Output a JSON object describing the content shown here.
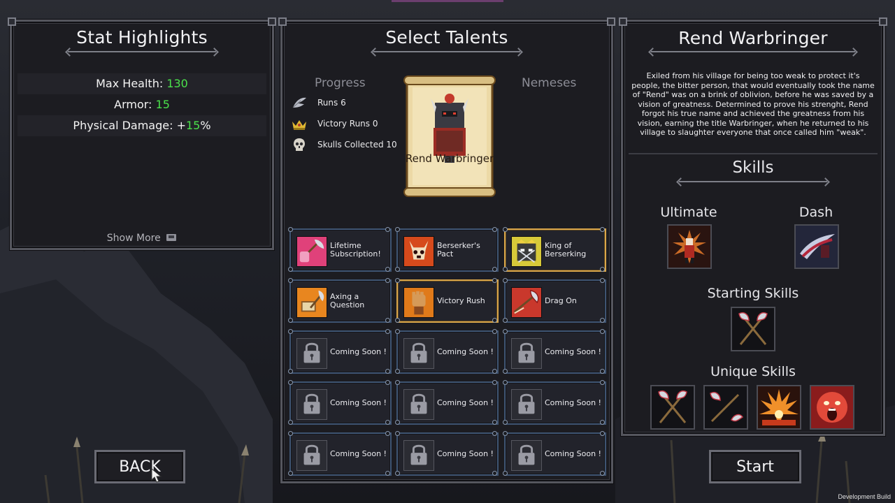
{
  "stat_highlights": {
    "title": "Stat Highlights",
    "stats": [
      {
        "label": "Max Health: ",
        "value": "130",
        "suffix": ""
      },
      {
        "label": "Armor: ",
        "value": "15",
        "suffix": ""
      },
      {
        "label": "Physical Damage: +",
        "value": "15",
        "suffix": "%"
      }
    ],
    "show_more": "Show More"
  },
  "select_talents": {
    "title": "Select Talents",
    "progress_header": "Progress",
    "nemeses_header": "Nemeses",
    "progress": [
      {
        "icon": "feather-wing-icon",
        "text": "Runs 6"
      },
      {
        "icon": "crown-icon",
        "text": "Victory Runs 0"
      },
      {
        "icon": "skull-icon",
        "text": "Skulls Collected 10"
      }
    ],
    "character_name": "Rend Warbringer",
    "talents": [
      {
        "name": "Lifetime Subscription!",
        "icon": "axe-shield-icon",
        "color": "#e0417a",
        "highlight": false
      },
      {
        "name": "Berserker's Pact",
        "icon": "demon-skull-icon",
        "color": "#d64a1c",
        "highlight": false
      },
      {
        "name": "King of Berserking",
        "icon": "crowned-face-icon",
        "color": "#d7c939",
        "highlight": true
      },
      {
        "name": "Axing a Question",
        "icon": "axe-book-icon",
        "color": "#e8861f",
        "highlight": false
      },
      {
        "name": "Victory Rush",
        "icon": "raised-fist-icon",
        "color": "#e07a1a",
        "highlight": true
      },
      {
        "name": "Drag On",
        "icon": "dragging-axe-icon",
        "color": "#c9382c",
        "highlight": false
      },
      {
        "name": "Coming Soon !",
        "icon": "lock-icon",
        "color": "#2b2c33",
        "highlight": false
      },
      {
        "name": "Coming Soon !",
        "icon": "lock-icon",
        "color": "#2b2c33",
        "highlight": false
      },
      {
        "name": "Coming Soon !",
        "icon": "lock-icon",
        "color": "#2b2c33",
        "highlight": false
      },
      {
        "name": "Coming Soon !",
        "icon": "lock-icon",
        "color": "#2b2c33",
        "highlight": false
      },
      {
        "name": "Coming Soon !",
        "icon": "lock-icon",
        "color": "#2b2c33",
        "highlight": false
      },
      {
        "name": "Coming Soon !",
        "icon": "lock-icon",
        "color": "#2b2c33",
        "highlight": false
      },
      {
        "name": "Coming Soon !",
        "icon": "lock-icon",
        "color": "#2b2c33",
        "highlight": false
      },
      {
        "name": "Coming Soon !",
        "icon": "lock-icon",
        "color": "#2b2c33",
        "highlight": false
      },
      {
        "name": "Coming Soon !",
        "icon": "lock-icon",
        "color": "#2b2c33",
        "highlight": false
      }
    ]
  },
  "character": {
    "name": "Rend Warbringer",
    "bio": "Exiled from his village for being too weak to protect it's people, the bitter person, that would eventually took the name of \"Rend\" was on a brink of oblivion, before he was saved by a vision of greatness. Determined to prove his strenght, Rend forgot his true name and achieved the greatness from his vision, earning the title Warbringer, when he returned to his village to slaughter everyone that once called him \"weak\".",
    "skills_title": "Skills",
    "ultimate_label": "Ultimate",
    "dash_label": "Dash",
    "starting_label": "Starting Skills",
    "unique_label": "Unique Skills"
  },
  "buttons": {
    "back": "BACK",
    "start": "Start"
  },
  "footer": {
    "dev_build": "Development Build"
  },
  "colors": {
    "stat_value": "#4be34b",
    "talent_border": "#3e5472",
    "talent_highlight": "#d9a64a"
  }
}
